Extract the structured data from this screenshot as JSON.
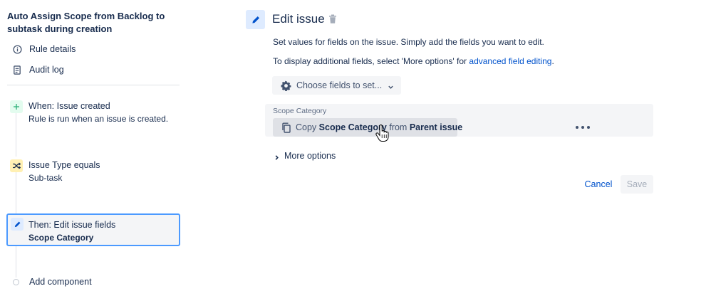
{
  "sidebar": {
    "rule_title": "Auto Assign Scope from Backlog to subtask during creation",
    "nav": [
      {
        "label": "Rule details",
        "icon": "info-icon"
      },
      {
        "label": "Audit log",
        "icon": "document-icon"
      }
    ],
    "steps": [
      {
        "title": "When: Issue created",
        "subtitle": "Rule is run when an issue is created.",
        "icon": "plus-icon",
        "badge_color": "#e3fcef",
        "icon_color": "#36b37e"
      },
      {
        "title": "Issue Type equals",
        "subtitle": "Sub-task",
        "icon": "shuffle-icon",
        "badge_color": "#fff0b3",
        "icon_color": "#172b4d"
      },
      {
        "title": "Then: Edit issue fields",
        "subtitle": "Scope Category",
        "icon": "pencil-icon",
        "badge_color": "#deebff",
        "icon_color": "#0052cc",
        "selected": true
      }
    ],
    "add_component": "Add component"
  },
  "editor": {
    "title": "Edit issue",
    "description": "Set values for fields on the issue. Simply add the fields you want to edit.",
    "display_prefix": "To display additional fields, select 'More options' for ",
    "display_link": "advanced field editing",
    "display_suffix": ".",
    "choose_fields": "Choose fields to set...",
    "field": {
      "label": "Scope Category",
      "copy_prefix": "Copy ",
      "copy_field": "Scope Category",
      "copy_middle": " from ",
      "copy_source": "Parent issue"
    },
    "more_options": "More options",
    "cancel": "Cancel",
    "save": "Save"
  },
  "colors": {
    "accent": "#0052cc",
    "selection_border": "#4c9aff",
    "text": "#172b4d"
  }
}
